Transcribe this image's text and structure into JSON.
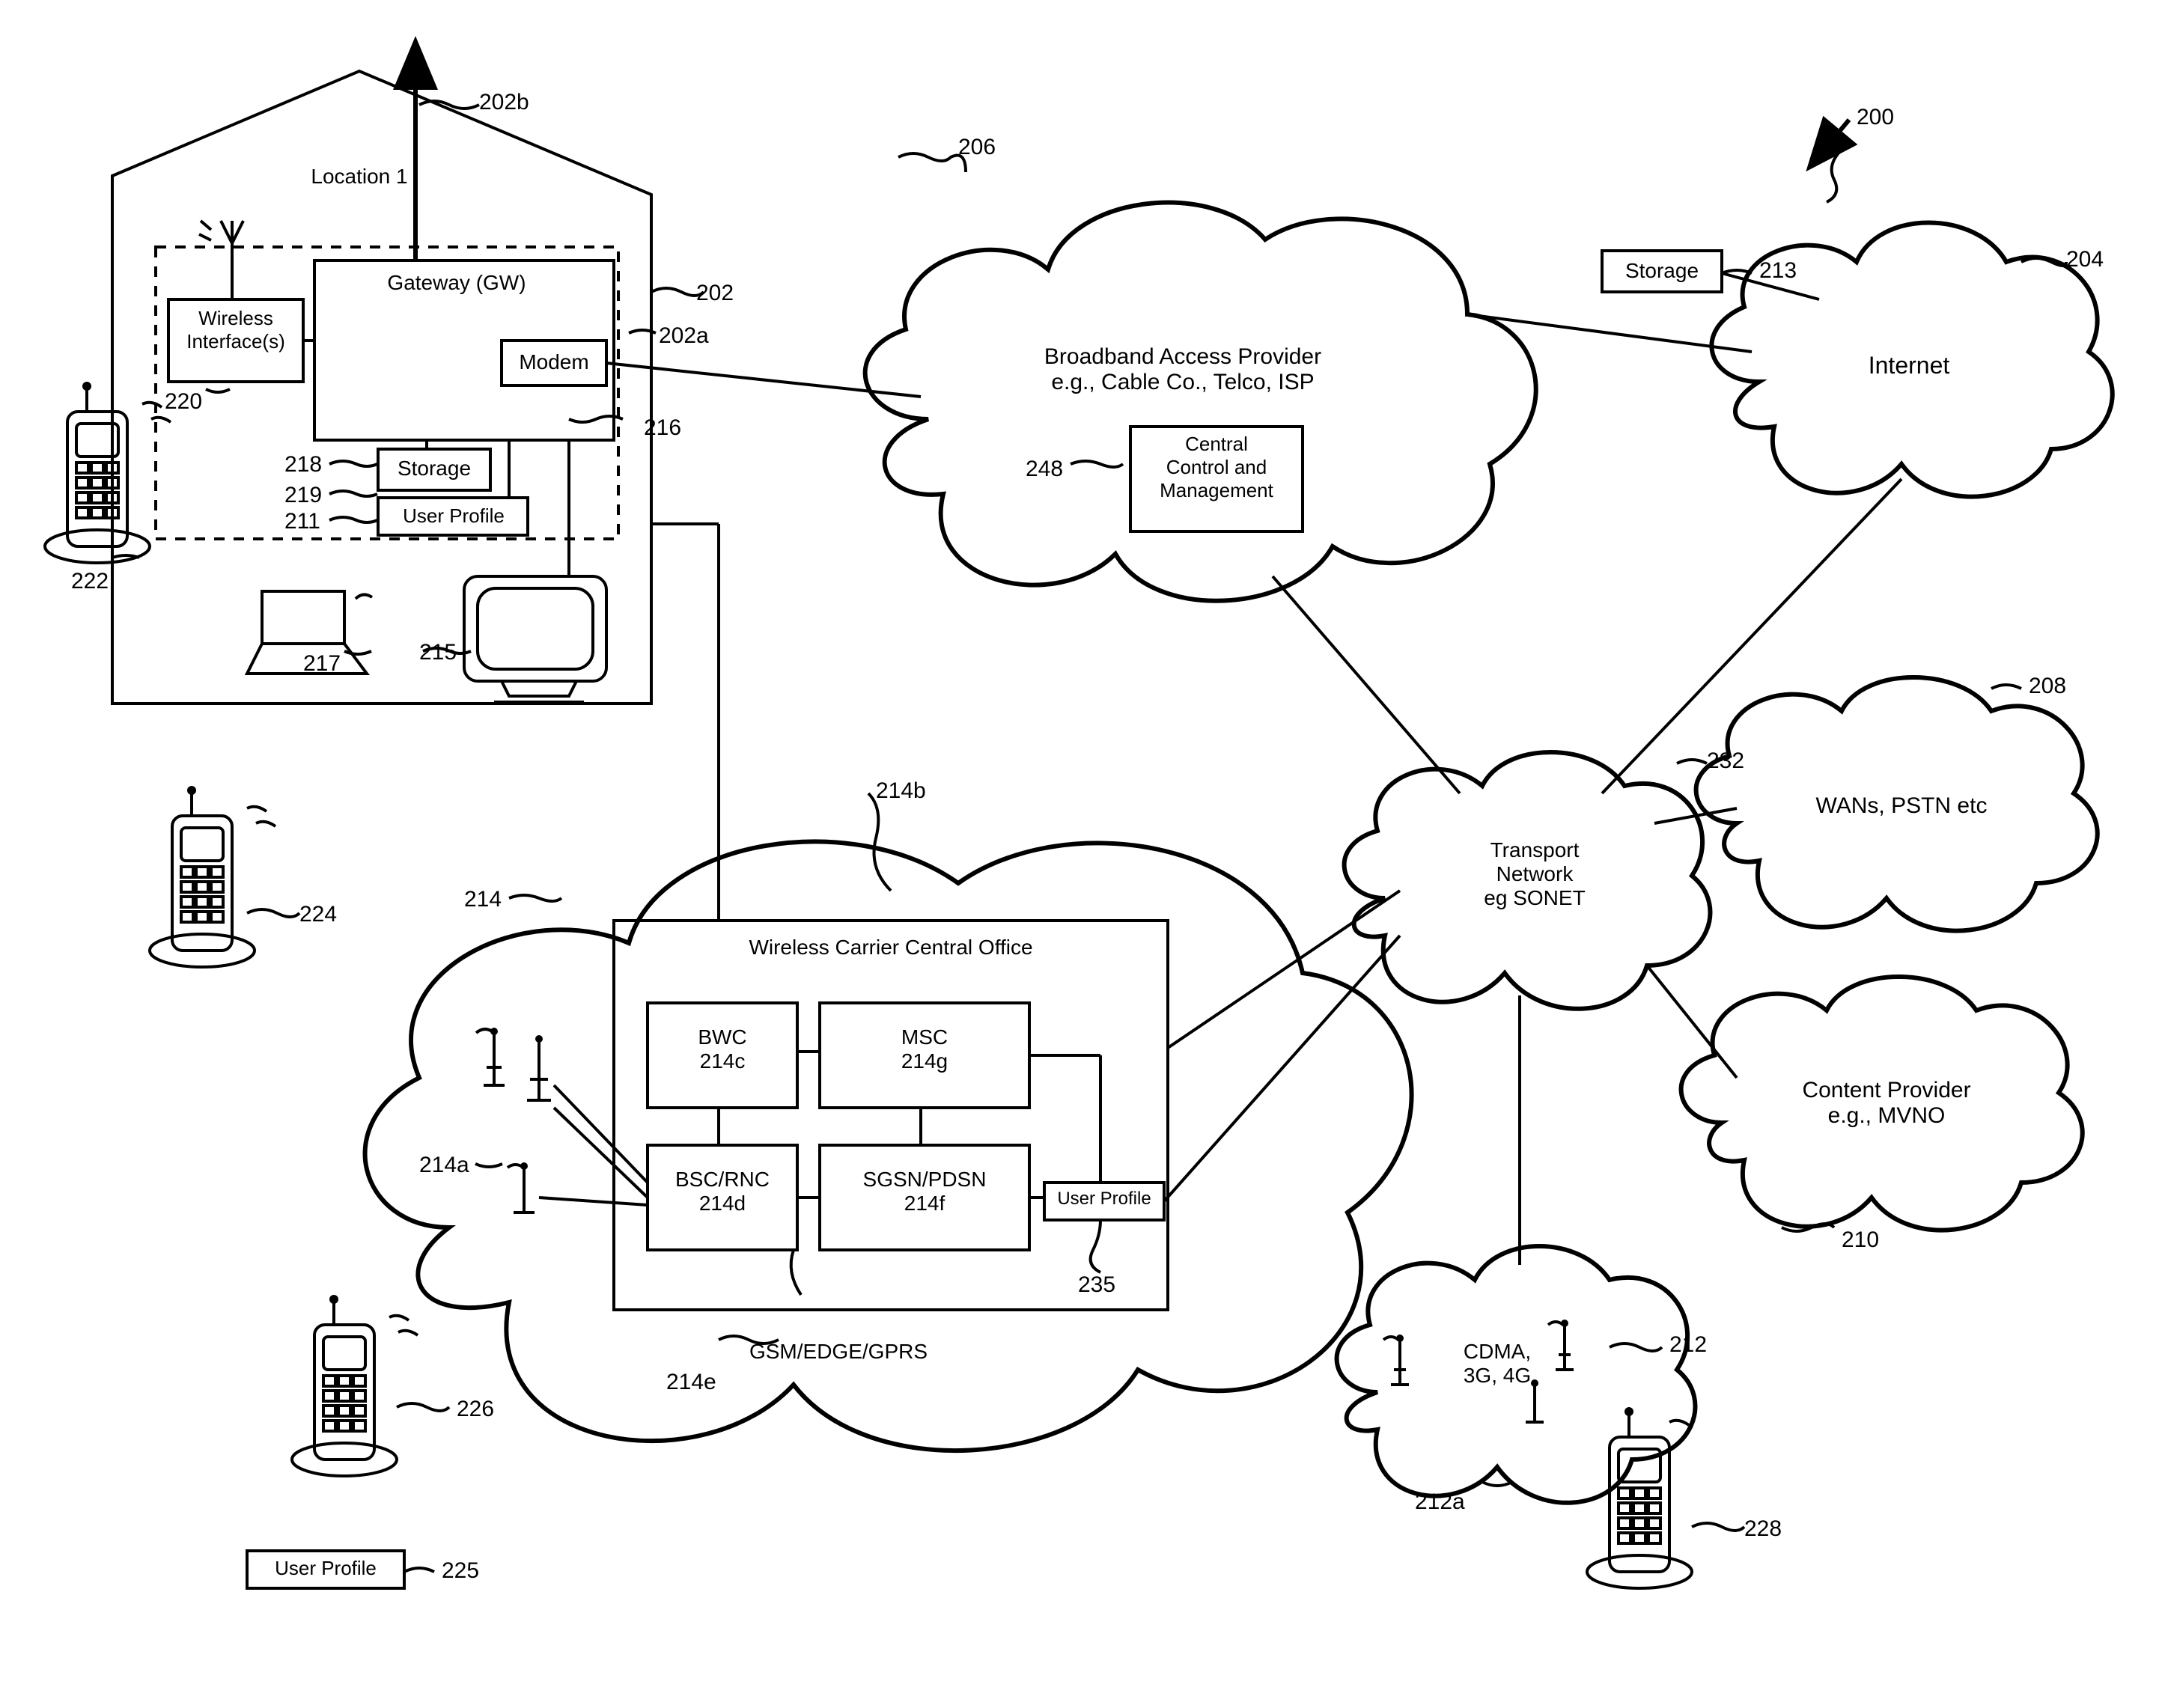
{
  "refs": {
    "r200": "200",
    "r202": "202",
    "r202a": "202a",
    "r202b": "202b",
    "r204": "204",
    "r206": "206",
    "r208": "208",
    "r210": "210",
    "r211": "211",
    "r212": "212",
    "r212a": "212a",
    "r213": "213",
    "r214": "214",
    "r214a": "214a",
    "r214b": "214b",
    "r214e": "214e",
    "r215": "215",
    "r216": "216",
    "r217": "217",
    "r218": "218",
    "r219": "219",
    "r220": "220",
    "r222": "222",
    "r224": "224",
    "r225": "225",
    "r226": "226",
    "r228": "228",
    "r232": "232",
    "r235": "235",
    "r248": "248"
  },
  "location1": {
    "title": "Location 1",
    "gateway": "Gateway (GW)",
    "modem": "Modem",
    "wirelessInterfaces": "Wireless\nInterface(s)",
    "storage": "Storage",
    "userProfile": "User Profile"
  },
  "broadbandProvider": {
    "title": "Broadband Access Provider\ne.g., Cable Co., Telco, ISP",
    "centralControl": "Central\nControl and\nManagement"
  },
  "storageBox": "Storage",
  "internet": "Internet",
  "wansPstn": "WANs, PSTN etc",
  "transportNetwork": "Transport\nNetwork\neg SONET",
  "contentProvider": "Content Provider\ne.g., MVNO",
  "cdma": "CDMA,\n3G, 4G",
  "userProfileBottom": "User Profile",
  "wirelessCarrier": {
    "title": "Wireless Carrier Central Office",
    "bwc": "BWC\n214c",
    "msc": "MSC\n214g",
    "bscRnc": "BSC/RNC\n214d",
    "sgsnPdsn": "SGSN/PDSN\n214f",
    "userProfile": "User Profile",
    "gsmEdge": "GSM/EDGE/GPRS"
  }
}
